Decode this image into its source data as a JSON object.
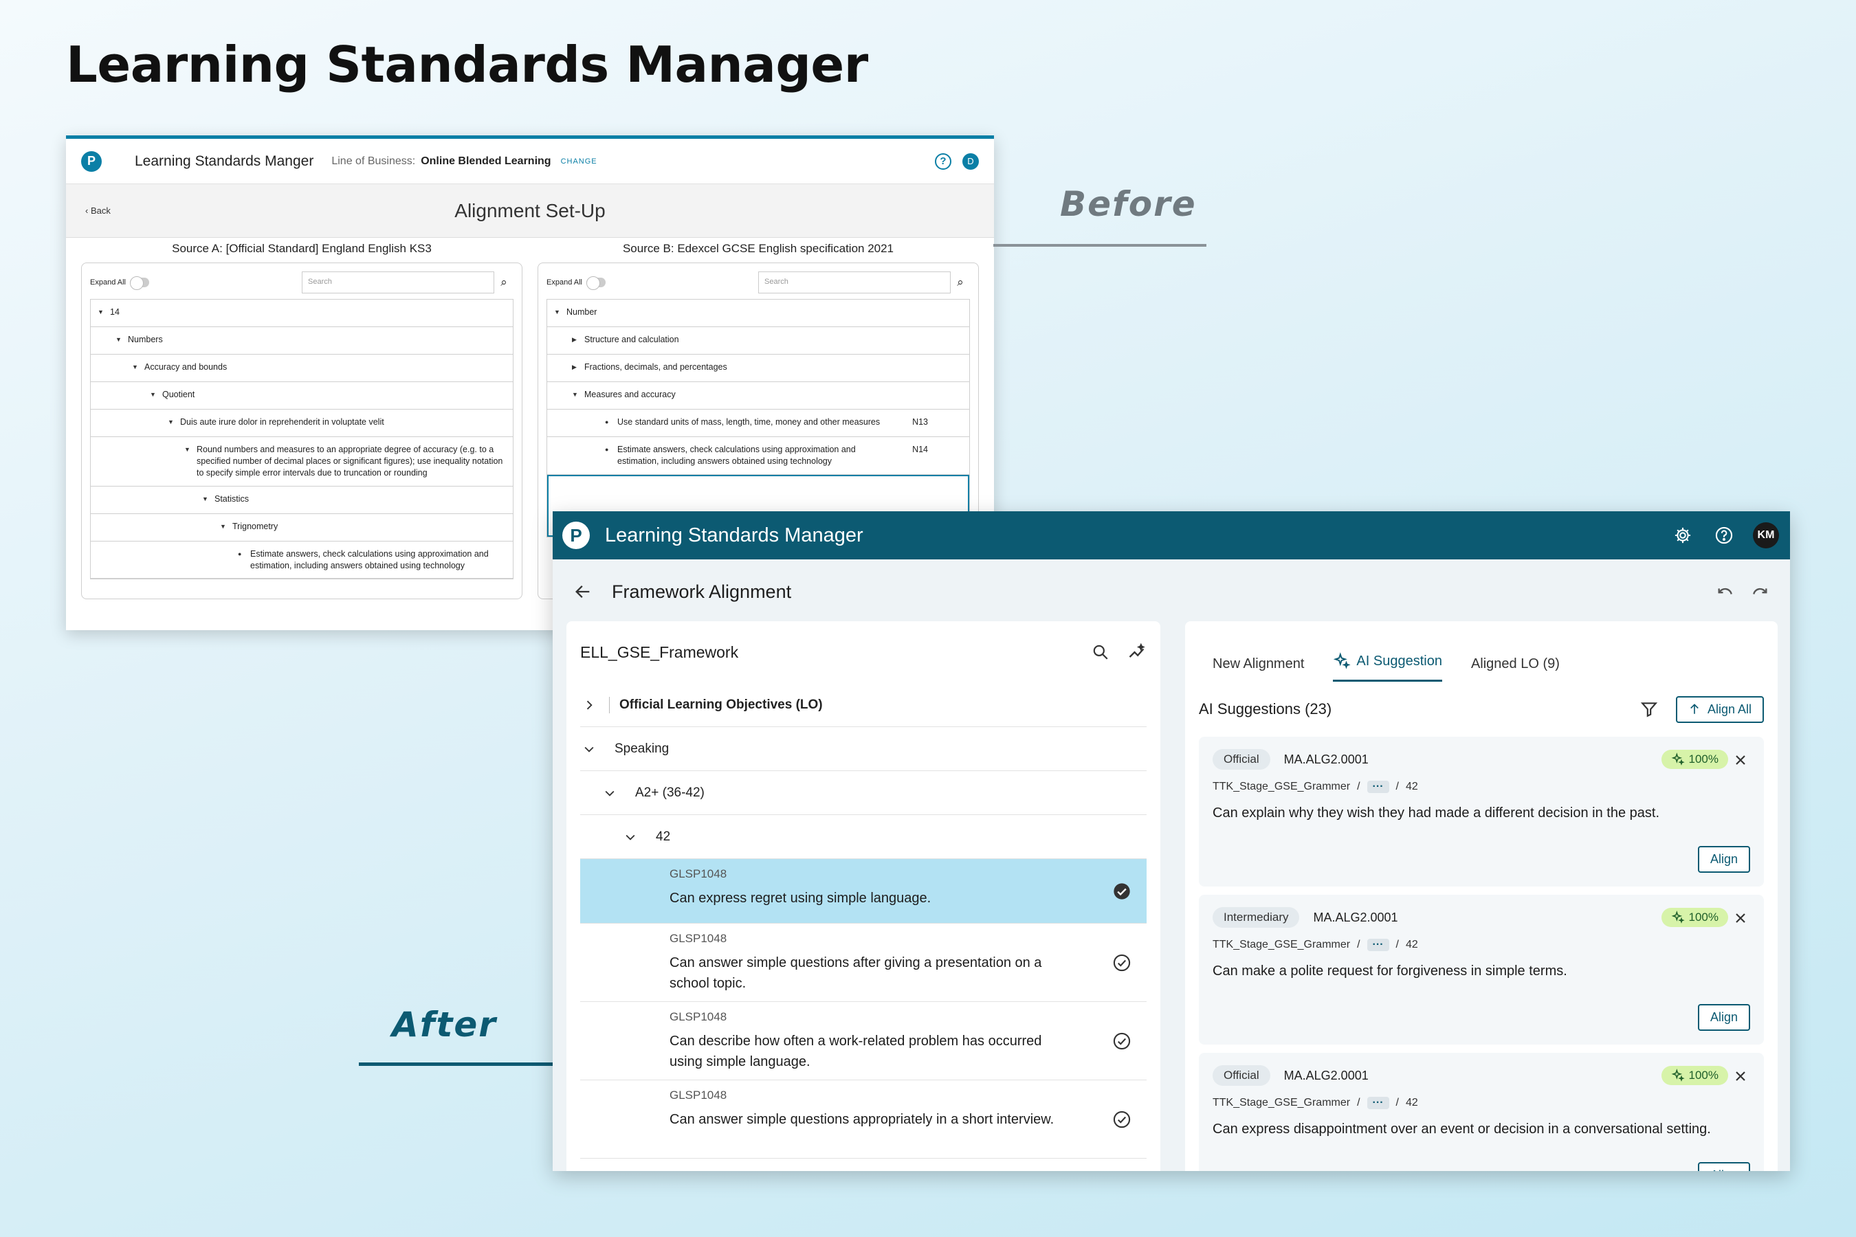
{
  "page": {
    "title": "Learning Standards Manager",
    "before_label": "Before",
    "after_label": "After"
  },
  "before": {
    "app_name": "Learning Standards Manger",
    "lob_label": "Line of Business:",
    "lob_value": "Online Blended Learning",
    "change_label": "CHANGE",
    "avatar": "D",
    "back_label": "Back",
    "heading": "Alignment Set-Up",
    "source_a": {
      "title": "Source A: [Official Standard] England English KS3",
      "expand_label": "Expand All",
      "search_placeholder": "Search",
      "rows": [
        {
          "text": "14",
          "code": ""
        },
        {
          "text": "Numbers",
          "code": ""
        },
        {
          "text": "Accuracy and bounds",
          "code": ""
        },
        {
          "text": "Quotient",
          "code": ""
        },
        {
          "text": "Duis aute irure dolor in reprehenderit in voluptate velit",
          "code": ""
        },
        {
          "text": "Round numbers and measures to an appropriate degree of accuracy (e.g. to a specified number of decimal places or significant figures); use inequality notation to specify simple error intervals due to truncation or rounding",
          "code": ""
        },
        {
          "text": "Statistics",
          "code": ""
        },
        {
          "text": "Trignometry",
          "code": ""
        },
        {
          "text": "Estimate answers, check calculations using approximation and estimation, including answers obtained using technology",
          "code": ""
        }
      ]
    },
    "source_b": {
      "title": "Source B: Edexcel GCSE English specification 2021",
      "expand_label": "Expand All",
      "search_placeholder": "Search",
      "rows": [
        {
          "text": "Number",
          "code": ""
        },
        {
          "text": "Structure and calculation",
          "code": ""
        },
        {
          "text": "Fractions, decimals, and percentages",
          "code": ""
        },
        {
          "text": "Measures and accuracy",
          "code": ""
        },
        {
          "text": "Use standard units of mass, length, time, money and other measures",
          "code": "N13"
        },
        {
          "text": "Estimate answers, check calculations using approximation and estimation, including answers obtained using technology",
          "code": "N14"
        }
      ]
    }
  },
  "after": {
    "app_name": "Learning Standards Manager",
    "avatar": "KM",
    "page_title": "Framework Alignment",
    "framework": "ELL_GSE_Framework",
    "tree": {
      "official": "Official Learning Objectives (LO)",
      "speaking": "Speaking",
      "level": "A2+ (36-42)",
      "score": "42"
    },
    "objectives": [
      {
        "code": "GLSP1048",
        "text": "Can express regret using simple language.",
        "active": true
      },
      {
        "code": "GLSP1048",
        "text": "Can answer simple questions after giving a presentation on a school topic.",
        "active": false
      },
      {
        "code": "GLSP1048",
        "text": "Can describe how often a work-related problem has occurred using simple language.",
        "active": false
      },
      {
        "code": "GLSP1048",
        "text": "Can answer simple questions appropriately in a short interview.",
        "active": false
      }
    ],
    "tabs": {
      "new_alignment": "New Alignment",
      "ai_suggestion": "AI Suggestion",
      "aligned_lo": "Aligned LO (9)"
    },
    "suggestions_title": "AI Suggestions (23)",
    "align_all": "Align All",
    "align": "Align",
    "ellipsis": "···",
    "suggestions": [
      {
        "type": "Official",
        "id": "MA.ALG2.0001",
        "score": "100%",
        "path_start": "TTK_Stage_GSE_Grammer",
        "path_end": "42",
        "text": "Can explain why they wish they had made a different decision in the past."
      },
      {
        "type": "Intermediary",
        "id": "MA.ALG2.0001",
        "score": "100%",
        "path_start": "TTK_Stage_GSE_Grammer",
        "path_end": "42",
        "text": "Can make a polite request for forgiveness in simple terms."
      },
      {
        "type": "Official",
        "id": "MA.ALG2.0001",
        "score": "100%",
        "path_start": "TTK_Stage_GSE_Grammer",
        "path_end": "42",
        "text": "Can express disappointment over an event or decision in a conversational setting."
      }
    ],
    "colors": {
      "brand": "#0c5a72",
      "active_row": "#b3e2f3",
      "score_chip": "#d7f3a9"
    }
  }
}
